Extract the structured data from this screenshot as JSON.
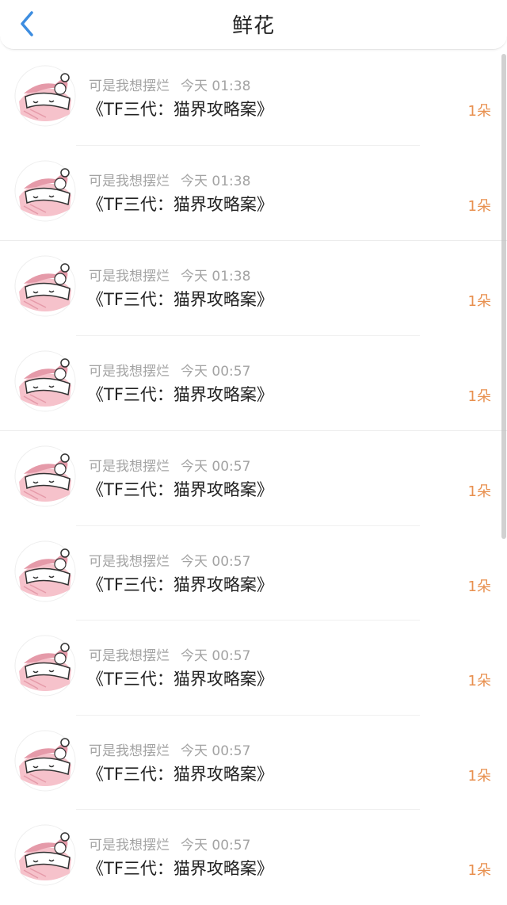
{
  "header": {
    "title": "鲜花",
    "back_icon": "chevron-left-icon",
    "accent_color": "#3d8de0"
  },
  "list": {
    "items": [
      {
        "user": "可是我想摆烂",
        "time": "今天 01:38",
        "book": "《TF三代：猫界攻略案》",
        "count": "1朵"
      },
      {
        "user": "可是我想摆烂",
        "time": "今天 01:38",
        "book": "《TF三代：猫界攻略案》",
        "count": "1朵"
      },
      {
        "user": "可是我想摆烂",
        "time": "今天 01:38",
        "book": "《TF三代：猫界攻略案》",
        "count": "1朵"
      },
      {
        "user": "可是我想摆烂",
        "time": "今天 00:57",
        "book": "《TF三代：猫界攻略案》",
        "count": "1朵"
      },
      {
        "user": "可是我想摆烂",
        "time": "今天 00:57",
        "book": "《TF三代：猫界攻略案》",
        "count": "1朵"
      },
      {
        "user": "可是我想摆烂",
        "time": "今天 00:57",
        "book": "《TF三代：猫界攻略案》",
        "count": "1朵"
      },
      {
        "user": "可是我想摆烂",
        "time": "今天 00:57",
        "book": "《TF三代：猫界攻略案》",
        "count": "1朵"
      },
      {
        "user": "可是我想摆烂",
        "time": "今天 00:57",
        "book": "《TF三代：猫界攻略案》",
        "count": "1朵"
      },
      {
        "user": "可是我想摆烂",
        "time": "今天 00:57",
        "book": "《TF三代：猫界攻略案》",
        "count": "1朵"
      }
    ],
    "avatar_icon": "cat-avatar-icon",
    "count_color": "#e8904f"
  }
}
